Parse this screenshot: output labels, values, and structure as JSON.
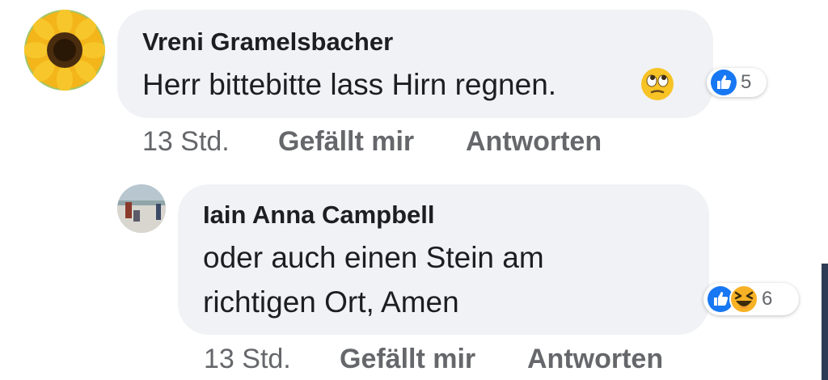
{
  "comments": [
    {
      "author": "Vreni Gramelsbacher",
      "text": "Herr bittebitte lass Hirn regnen.",
      "emoji": "face-with-rolling-eyes",
      "time": "13 Std.",
      "like_label": "Gefällt mir",
      "reply_label": "Antworten",
      "reaction_count": "5",
      "reactions": [
        "like"
      ]
    }
  ],
  "replies": [
    {
      "author": "Iain Anna Campbell",
      "text_line1": "oder auch einen Stein am",
      "text_line2": "richtigen Ort, Amen",
      "time": "13 Std.",
      "like_label": "Gefällt mir",
      "reply_label": "Antworten",
      "reaction_count": "6",
      "reactions": [
        "like",
        "haha"
      ]
    }
  ],
  "colors": {
    "bubble": "#f0f2f5",
    "meta_text": "#65676b",
    "like_blue": "#1877f2",
    "haha_yellow": "#f7b125"
  }
}
